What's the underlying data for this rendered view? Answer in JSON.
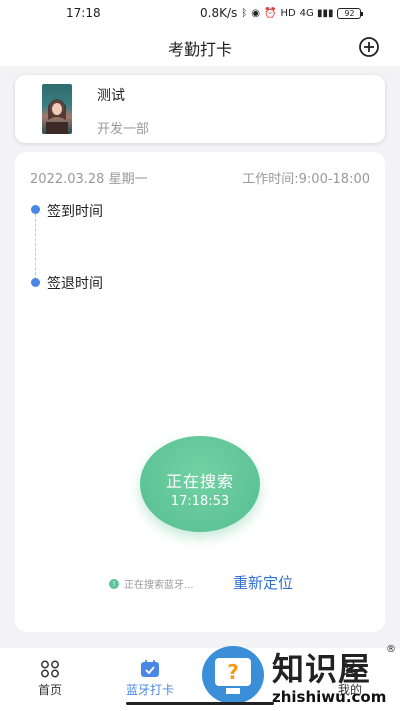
{
  "status_bar": {
    "time": "17:18",
    "network_speed": "0.8K/s",
    "icons": [
      "bluetooth-icon",
      "hd-call-icon",
      "alarm-icon",
      "hd-icon",
      "4g-signal-icon"
    ],
    "battery": "92"
  },
  "app_bar": {
    "title": "考勤打卡",
    "add_icon": "plus-circle-icon"
  },
  "user": {
    "name": "测试",
    "department": "开发一部"
  },
  "attendance": {
    "date": "2022.03.28  星期一",
    "work_time": "工作时间:9:00-18:00",
    "check_in_label": "签到时间",
    "check_out_label": "签退时间"
  },
  "search": {
    "label": "正在搜索",
    "clock": "17:18:53",
    "status_text": "正在搜索蓝牙...",
    "relocate_label": "重新定位"
  },
  "tabs": [
    {
      "label": "首页",
      "icon": "grid-icon",
      "active": false
    },
    {
      "label": "蓝牙打卡",
      "icon": "calendar-check-icon",
      "active": true
    },
    {
      "label": "我的",
      "icon": "person-icon",
      "active": false
    }
  ],
  "watermark": {
    "cn": "知识屋",
    "en": "zhishiwu.com",
    "reg": "®"
  },
  "colors": {
    "accent_blue": "#4a86e6",
    "search_green": "#5ec497",
    "link_blue": "#2f6fd0",
    "background": "#f3f3f5"
  }
}
